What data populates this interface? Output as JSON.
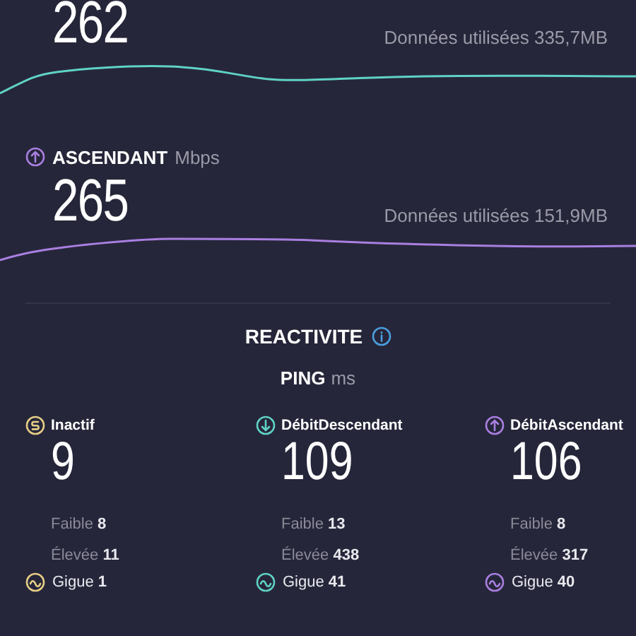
{
  "download": {
    "value": "262",
    "data_used": "Données utilisées 335,7MB"
  },
  "upload": {
    "label": "ASCENDANT",
    "unit": "Mbps",
    "value": "265",
    "data_used": "Données utilisées 151,9MB"
  },
  "responsiveness": {
    "title": "REACTIVITE",
    "ping_label": "PING",
    "ping_unit": "ms",
    "columns": [
      {
        "kind": "idle",
        "color": "#e6cf86",
        "label": "Inactif",
        "value": "9",
        "low_label": "Faible",
        "low": "8",
        "high_label": "Élevée",
        "high": "11",
        "jitter_label": "Gigue",
        "jitter": "1"
      },
      {
        "kind": "download",
        "color": "#5fd3c6",
        "label": "DébitDescendant",
        "value": "109",
        "low_label": "Faible",
        "low": "13",
        "high_label": "Élevée",
        "high": "438",
        "jitter_label": "Gigue",
        "jitter": "41"
      },
      {
        "kind": "upload",
        "color": "#a97fe0",
        "label": "DébitAscendant",
        "value": "106",
        "low_label": "Faible",
        "low": "8",
        "high_label": "Élevée",
        "high": "317",
        "jitter_label": "Gigue",
        "jitter": "40"
      }
    ]
  }
}
